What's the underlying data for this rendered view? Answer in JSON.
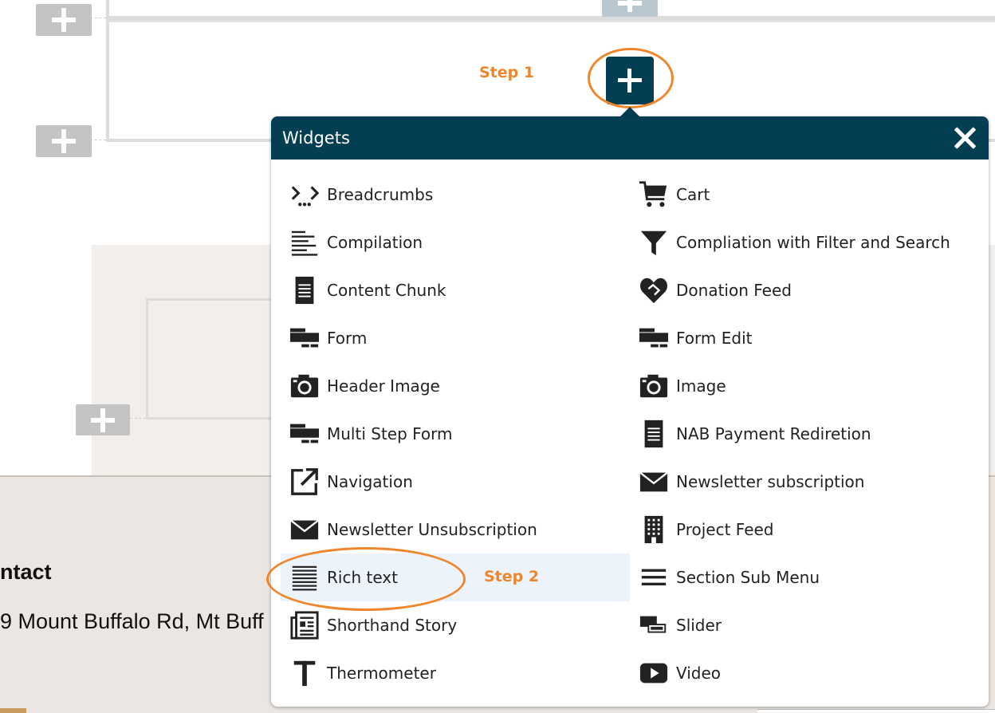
{
  "annotations": {
    "step1": "Step 1",
    "step2": "Step 2"
  },
  "popup": {
    "title": "Widgets",
    "close_icon": "close-icon",
    "header_color": "#033e52",
    "widgets_left": [
      {
        "label": "Breadcrumbs",
        "icon": "breadcrumbs-icon"
      },
      {
        "label": "Compilation",
        "icon": "compilation-icon"
      },
      {
        "label": "Content Chunk",
        "icon": "document-icon"
      },
      {
        "label": "Form",
        "icon": "form-icon"
      },
      {
        "label": "Header Image",
        "icon": "camera-icon"
      },
      {
        "label": "Multi Step Form",
        "icon": "form-icon"
      },
      {
        "label": "Navigation",
        "icon": "external-link-icon"
      },
      {
        "label": "Newsletter Unsubscription",
        "icon": "envelope-icon"
      },
      {
        "label": "Rich text",
        "icon": "rich-text-icon",
        "selected": true
      },
      {
        "label": "Shorthand Story",
        "icon": "newspaper-icon"
      },
      {
        "label": "Thermometer",
        "icon": "text-t-icon"
      }
    ],
    "widgets_right": [
      {
        "label": "Cart",
        "icon": "cart-icon"
      },
      {
        "label": "Compliation with Filter and Search",
        "icon": "filter-icon"
      },
      {
        "label": "Donation Feed",
        "icon": "heart-handshake-icon"
      },
      {
        "label": "Form Edit",
        "icon": "form-icon"
      },
      {
        "label": "Image",
        "icon": "camera-icon"
      },
      {
        "label": "NAB Payment Rediretion",
        "icon": "document-icon"
      },
      {
        "label": "Newsletter subscription",
        "icon": "envelope-icon"
      },
      {
        "label": "Project Feed",
        "icon": "building-icon"
      },
      {
        "label": "Section Sub Menu",
        "icon": "hamburger-icon"
      },
      {
        "label": "Slider",
        "icon": "slider-icon"
      },
      {
        "label": "Video",
        "icon": "play-icon"
      }
    ]
  },
  "footer": {
    "title": "ntact",
    "address": "9 Mount Buffalo Rd, Mt Buff"
  },
  "colors": {
    "accent_orange": "#f0862b",
    "selected_row": "#edf3fb"
  }
}
